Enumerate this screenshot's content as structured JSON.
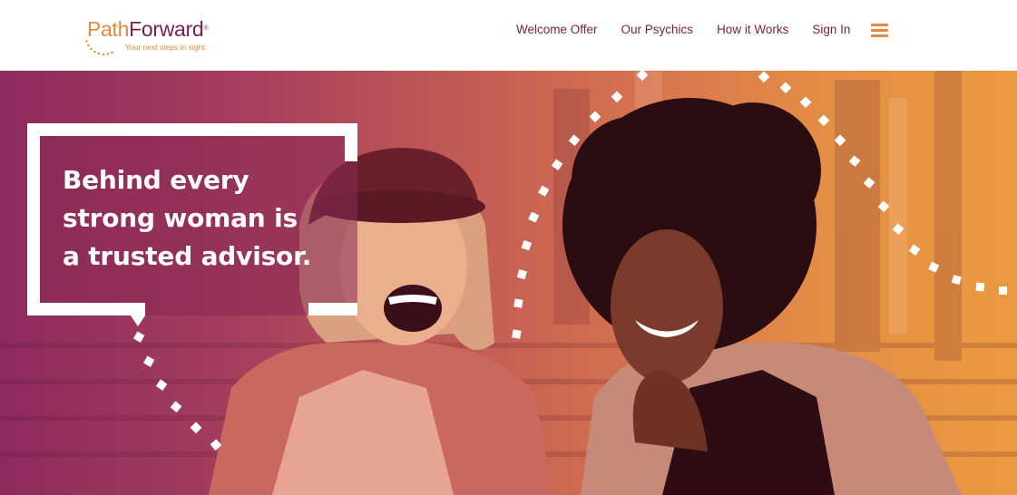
{
  "header": {
    "logo": {
      "part1": "Path",
      "part2": "Forward",
      "tm": "®",
      "tagline": "Your next steps in sight."
    },
    "nav": [
      {
        "label": "Welcome Offer"
      },
      {
        "label": "Our Psychics"
      },
      {
        "label": "How it Works"
      },
      {
        "label": "Sign In"
      }
    ],
    "menu_icon": "hamburger-menu-icon"
  },
  "hero": {
    "headline_lines": [
      "Behind every",
      "strong woman is",
      "a trusted advisor."
    ],
    "image": "two-laughing-women-photo"
  },
  "colors": {
    "brand_orange": "#e8883a",
    "brand_plum": "#7a1f4e",
    "nav_text": "#7a1f3a"
  }
}
